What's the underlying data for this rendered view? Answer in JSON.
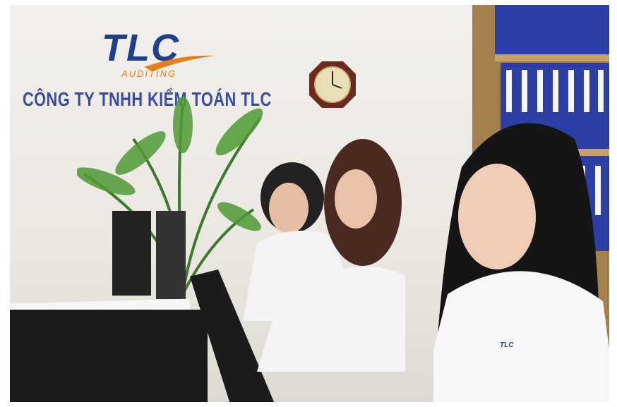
{
  "logo": {
    "brand": "TLC",
    "tagline": "AUDITING"
  },
  "sign": {
    "company_name": "CÔNG TY TNHH KIỂM TOÁN TLC"
  },
  "shirt_logo": "TLC",
  "colors": {
    "brand_blue": "#1f3f8c",
    "brand_orange": "#e3801c",
    "sign_text": "#3b49a8",
    "binder_blue": "#2b3fa6"
  }
}
